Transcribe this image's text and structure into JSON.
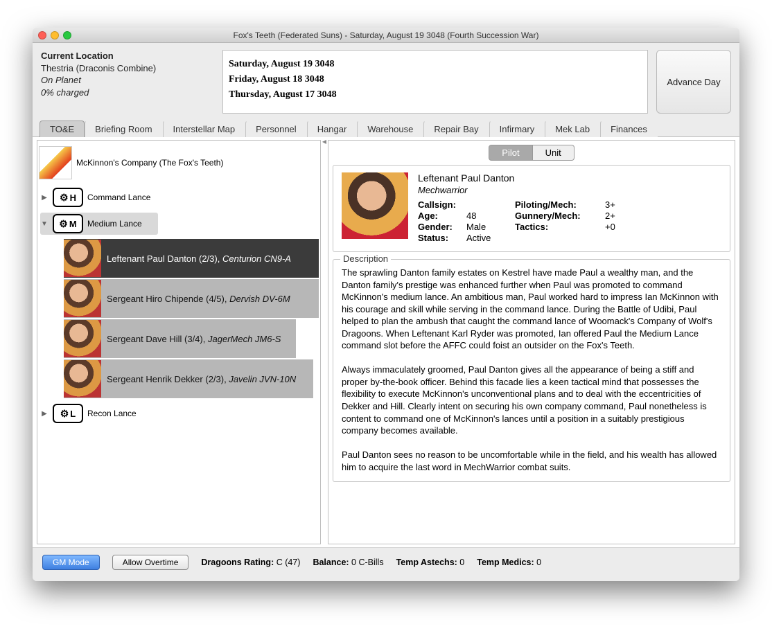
{
  "window": {
    "title": "Fox's Teeth (Federated Suns) - Saturday, August 19 3048 (Fourth Succession War)"
  },
  "header": {
    "location_label": "Current Location",
    "location_name": "Thestria (Draconis Combine)",
    "location_status": "On Planet",
    "location_charge": "0% charged",
    "advance_label": "Advance Day",
    "log": [
      "Saturday, August 19 3048",
      "Friday, August 18 3048",
      "Thursday, August 17 3048"
    ]
  },
  "tabs": [
    "TO&E",
    "Briefing Room",
    "Interstellar Map",
    "Personnel",
    "Hangar",
    "Warehouse",
    "Repair Bay",
    "Infirmary",
    "Mek Lab",
    "Finances"
  ],
  "active_tab": "TO&E",
  "tree": {
    "company": "McKinnon's Company (The Fox's Teeth)",
    "lances": [
      {
        "letter": "H",
        "name": "Command Lance",
        "expanded": false
      },
      {
        "letter": "M",
        "name": "Medium Lance",
        "expanded": true
      },
      {
        "letter": "L",
        "name": "Recon Lance",
        "expanded": false
      }
    ],
    "medium_pilots": [
      {
        "name": "Leftenant Paul Danton",
        "rating": "(2/3)",
        "mech": "Centurion CN9-A",
        "selected": true
      },
      {
        "name": "Sergeant Hiro Chipende",
        "rating": "(4/5)",
        "mech": "Dervish DV-6M",
        "selected": false
      },
      {
        "name": "Sergeant Dave Hill",
        "rating": "(3/4)",
        "mech": "JagerMech JM6-S",
        "selected": false
      },
      {
        "name": "Sergeant Henrik Dekker",
        "rating": "(2/3)",
        "mech": "Javelin JVN-10N",
        "selected": false
      }
    ]
  },
  "detail": {
    "subtabs": [
      "Pilot",
      "Unit"
    ],
    "active_subtab": "Pilot",
    "name": "Leftenant Paul Danton",
    "role": "Mechwarrior",
    "stats": {
      "callsign_k": "Callsign:",
      "callsign_v": "",
      "age_k": "Age:",
      "age_v": "48",
      "gender_k": "Gender:",
      "gender_v": "Male",
      "status_k": "Status:",
      "status_v": "Active",
      "piloting_k": "Piloting/Mech:",
      "piloting_v": "3+",
      "gunnery_k": "Gunnery/Mech:",
      "gunnery_v": "2+",
      "tactics_k": "Tactics:",
      "tactics_v": "+0"
    },
    "description_legend": "Description",
    "description": "The sprawling Danton family estates on Kestrel have made Paul a wealthy man, and the Danton family's prestige was enhanced further when Paul was promoted to command McKinnon's medium lance. An ambitious man, Paul worked hard to impress Ian McKinnon with his courage and skill while serving in the command lance. During the Battle of Udibi, Paul helped to plan the ambush that caught the command lance of Woomack's Company of Wolf's Dragoons. When Leftenant Karl Ryder was promoted, Ian offered Paul the Medium Lance command slot before the AFFC could foist an outsider on the Fox's Teeth.\n\nAlways immaculately groomed, Paul Danton gives all the appearance of being a stiff and proper by-the-book officer. Behind this facade lies a keen tactical mind that possesses the flexibility to execute McKinnon's unconventional plans and to deal with the eccentricities of Dekker and Hill. Clearly intent on securing his own company command, Paul nonetheless is content to command one of McKinnon's lances until a position in a suitably prestigious company becomes available.\n\nPaul Danton sees no reason to be uncomfortable while in the field, and his wealth has allowed him to acquire the last word in MechWarrior combat suits."
  },
  "footer": {
    "gm_mode": "GM Mode",
    "overtime": "Allow Overtime",
    "dragoons_k": "Dragoons Rating:",
    "dragoons_v": "C (47)",
    "balance_k": "Balance:",
    "balance_v": "0 C-Bills",
    "astechs_k": "Temp Astechs:",
    "astechs_v": "0",
    "medics_k": "Temp Medics:",
    "medics_v": "0"
  }
}
